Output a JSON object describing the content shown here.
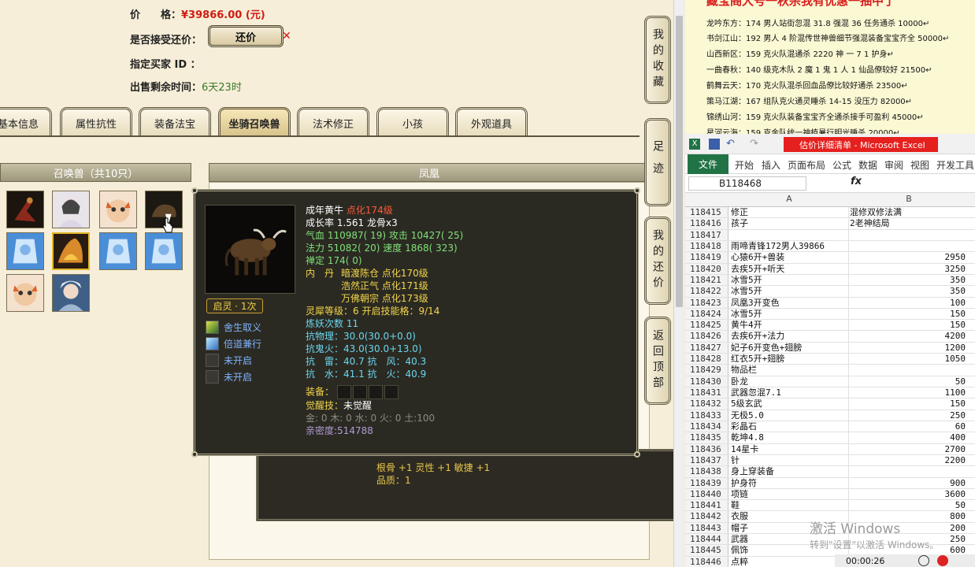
{
  "listing": {
    "price_label": "价　　格：",
    "price_value": "¥39866.00 (元)",
    "accept_counter_label": "是否接受还价：",
    "counter_button": "还价",
    "buyer_id_label": "指定买家 ID ：",
    "time_left_label": "出售剩余时间：",
    "time_left_value": "6天23时"
  },
  "tabs": [
    {
      "label": "基本信息"
    },
    {
      "label": "属性抗性"
    },
    {
      "label": "装备法宝"
    },
    {
      "label": "坐骑召唤兽",
      "active": true
    },
    {
      "label": "法术修正"
    },
    {
      "label": "小孩"
    },
    {
      "label": "外观道具"
    }
  ],
  "pets_panel": {
    "title": "召唤兽（共10只）",
    "count": 10
  },
  "detail_panel": {
    "title": "凤凰"
  },
  "tooltip": {
    "name": "成年黄牛",
    "level": "点化174级",
    "growth_label": "成长率 1.561 ",
    "bone": "龙骨x3",
    "hp_label": "气血 ",
    "hp": "110987( 19)",
    "atk_label": " 攻击 ",
    "atk": "10427( 25)",
    "mp_label": "法力 ",
    "mp": "51082( 20)",
    "spd_label": " 速度 ",
    "spd": "1868( 323)",
    "zen_label": "禅定 ",
    "zen": "174( 0)",
    "neidan_label": "内　丹",
    "neidan": [
      "暗渡陈仓 点化170级",
      "浩然正气 点化171级",
      "万佛朝宗 点化173级"
    ],
    "lingxi": "灵犀等级：6 开启技能格：9/14",
    "lianyao": "炼妖次数 11",
    "res_phys": "抗物理：30.0(30.0+0.0)",
    "res_ghost": "抗鬼火：43.0(30.0+13.0)",
    "res_line1": "抗　雷：40.7 抗　风：40.3",
    "res_line2": "抗　水：41.1 抗　火：40.9",
    "equip_label": "装备：",
    "awaken_label": "觉醒技：",
    "awaken_value": "未觉醒",
    "elements": "金: 0 木: 0 水: 0 火: 0 土:100",
    "intimacy": "亲密度:514788",
    "awaken_button": "启灵 · 1次",
    "skills": [
      "舍生取义",
      "倍道兼行",
      "未开启",
      "未开启"
    ]
  },
  "lower_panel": {
    "line1": "根骨 +1 灵性 +1 敏捷 +1",
    "line2": "品质：1"
  },
  "side_buttons": [
    {
      "label": "我的收藏"
    },
    {
      "label": "足迹"
    },
    {
      "label": "我的还价"
    },
    {
      "label": "返回顶部"
    }
  ],
  "notes": {
    "title": "藏宝阁大号一秋杀我有优惠一抽中了",
    "lines": [
      "龙吟东方：174 男人站街忽混 31.8 强混 36 任务通杀 10000↵",
      "书剑江山：192 男人 4 阶混传世神兽细节强混装备宝宝齐全 50000↵",
      "山西新区：159 克火队混通杀 2220 神 一 7 1 护身↵",
      "一曲春秋：140 级克木队 2 魔 1 鬼 1 人 1 仙品僚较好 21500↵",
      "鹤舞云天：170 克火队混杀回血品僚比较好通杀 23500↵",
      "策马江湖：167 组队克火通灵睡杀 14-15 没压力 82000↵",
      "锦绣山河：159 克火队装备宝宝齐全通杀接手可盈利 45000↵",
      "星河云海：159 克金队统一神植暑行明光睡杀 20000↵"
    ]
  },
  "excel": {
    "title": "估价详细清单 - Microsoft Excel",
    "file_tab": "文件",
    "ribbon_tabs": [
      "开始",
      "插入",
      "页面布局",
      "公式",
      "数据",
      "审阅",
      "视图",
      "开发工具"
    ],
    "namebox": "B118468",
    "fx": "fx",
    "columns": [
      "A",
      "B"
    ],
    "rows": [
      {
        "n": "118415",
        "a": "修正",
        "b": "混修双修法满",
        "num": false
      },
      {
        "n": "118416",
        "a": "孩子",
        "b": "2老神结局",
        "num": false
      },
      {
        "n": "118417",
        "a": "",
        "b": "",
        "num": false
      },
      {
        "n": "118418",
        "a": "雨啼青锋172男人39866",
        "b": "",
        "num": false
      },
      {
        "n": "118419",
        "a": "心猿6开+兽装",
        "b": "2950",
        "num": true
      },
      {
        "n": "118420",
        "a": "去疾5开+听天",
        "b": "3250",
        "num": true
      },
      {
        "n": "118421",
        "a": "冰雪5开",
        "b": "350",
        "num": true
      },
      {
        "n": "118422",
        "a": "冰雪5开",
        "b": "350",
        "num": true
      },
      {
        "n": "118423",
        "a": "凤凰3开变色",
        "b": "100",
        "num": true
      },
      {
        "n": "118424",
        "a": "冰雪5开",
        "b": "150",
        "num": true
      },
      {
        "n": "118425",
        "a": "黄牛4开",
        "b": "150",
        "num": true
      },
      {
        "n": "118426",
        "a": "去疾6开+法力",
        "b": "4200",
        "num": true
      },
      {
        "n": "118427",
        "a": "妃子6开变色+翅膀",
        "b": "1200",
        "num": true
      },
      {
        "n": "118428",
        "a": "红衣5开+翅膀",
        "b": "1050",
        "num": true
      },
      {
        "n": "118429",
        "a": "物品栏",
        "b": "",
        "num": false
      },
      {
        "n": "118430",
        "a": "卧龙",
        "b": "50",
        "num": true
      },
      {
        "n": "118431",
        "a": "武器忽混7.1",
        "b": "1100",
        "num": true
      },
      {
        "n": "118432",
        "a": "5级玄武",
        "b": "150",
        "num": true
      },
      {
        "n": "118433",
        "a": "无极5.0",
        "b": "250",
        "num": true
      },
      {
        "n": "118434",
        "a": "彩晶石",
        "b": "60",
        "num": true
      },
      {
        "n": "118435",
        "a": "乾坤4.8",
        "b": "400",
        "num": true
      },
      {
        "n": "118436",
        "a": "14星卡",
        "b": "2700",
        "num": true
      },
      {
        "n": "118437",
        "a": "针",
        "b": "2200",
        "num": true
      },
      {
        "n": "118438",
        "a": "身上穿装备",
        "b": "",
        "num": false
      },
      {
        "n": "118439",
        "a": "护身符",
        "b": "900",
        "num": true
      },
      {
        "n": "118440",
        "a": "项链",
        "b": "3600",
        "num": true
      },
      {
        "n": "118441",
        "a": "鞋",
        "b": "50",
        "num": true
      },
      {
        "n": "118442",
        "a": "衣服",
        "b": "800",
        "num": true
      },
      {
        "n": "118443",
        "a": "帽子",
        "b": "200",
        "num": true
      },
      {
        "n": "118444",
        "a": "武器",
        "b": "250",
        "num": true
      },
      {
        "n": "118445",
        "a": "佩饰",
        "b": "600",
        "num": true
      },
      {
        "n": "118446",
        "a": "点粹",
        "b": "",
        "num": false
      }
    ]
  },
  "watermark": {
    "line1": "激活 Windows",
    "line2": "转到\"设置\"以激活 Windows。"
  },
  "recorder": {
    "time": "00:00:26"
  }
}
